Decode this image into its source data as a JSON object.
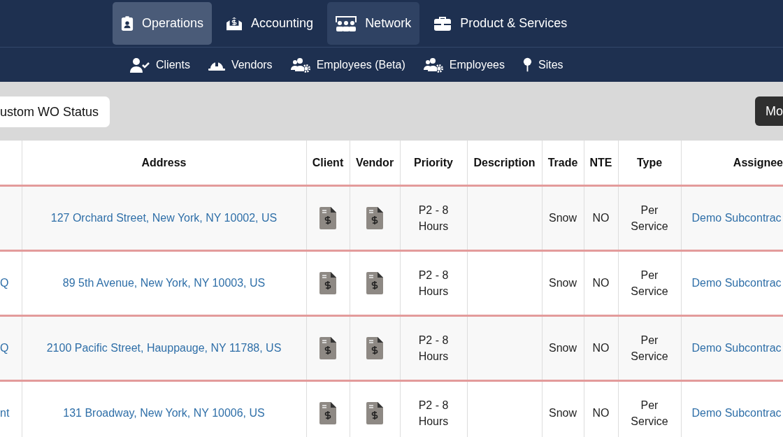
{
  "main_nav": [
    {
      "label": "Operations",
      "selected": true,
      "hovered": false
    },
    {
      "label": "Accounting",
      "selected": false,
      "hovered": false
    },
    {
      "label": "Network",
      "selected": false,
      "hovered": true
    },
    {
      "label": "Product & Services",
      "selected": false,
      "hovered": false
    }
  ],
  "sub_nav": [
    {
      "label": "Clients"
    },
    {
      "label": "Vendors"
    },
    {
      "label": "Employees (Beta)"
    },
    {
      "label": "Employees"
    },
    {
      "label": "Sites"
    }
  ],
  "toolbar": {
    "left_button": "ustom WO Status",
    "right_button": "Mo"
  },
  "table": {
    "columns": [
      "Address",
      "Client",
      "Vendor",
      "Priority",
      "Description",
      "Trade",
      "NTE",
      "Type",
      "Assignee"
    ],
    "rows": [
      {
        "address": "127 Orchard Street, New York, NY 10002, US",
        "priority": "P2 - 8 Hours",
        "trade": "Snow",
        "nte": "NO",
        "type": "Per Service",
        "assignee": "Demo Subcontrac"
      },
      {
        "column_1": "Q",
        "address": "89 5th Avenue, New York, NY 10003, US",
        "priority": "P2 - 8 Hours",
        "trade": "Snow",
        "nte": "NO",
        "type": "Per Service",
        "assignee": "Demo Subcontrac"
      },
      {
        "column_1": "Q",
        "address": "2100 Pacific Street, Hauppauge, NY 11788, US",
        "priority": "P2 - 8 Hours",
        "trade": "Snow",
        "nte": "NO",
        "type": "Per Service",
        "assignee": "Demo Subcontrac"
      },
      {
        "column_1": "nt",
        "address": "131 Broadway, New York, NY 10006, US",
        "priority": "P2 - 8 Hours",
        "trade": "Snow",
        "nte": "NO",
        "type": "Per Service",
        "assignee": "Demo Subcontrac"
      }
    ]
  }
}
